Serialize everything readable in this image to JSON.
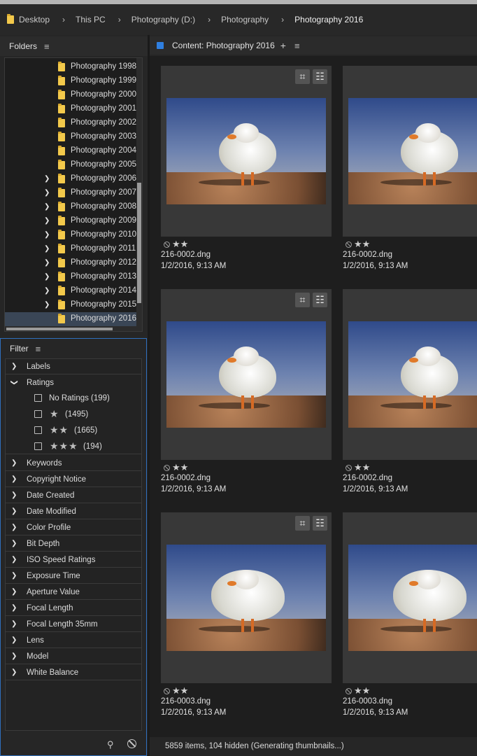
{
  "breadcrumb": {
    "items": [
      "Desktop",
      "This PC",
      "Photography (D:)",
      "Photography",
      "Photography 2016"
    ],
    "separator": "›"
  },
  "folders": {
    "title": "Folders",
    "items": [
      {
        "label": "Photography 1998",
        "expandable": false
      },
      {
        "label": "Photography 1999",
        "expandable": false
      },
      {
        "label": "Photography 2000",
        "expandable": false
      },
      {
        "label": "Photography 2001",
        "expandable": false
      },
      {
        "label": "Photography 2002",
        "expandable": false
      },
      {
        "label": "Photography 2003",
        "expandable": false
      },
      {
        "label": "Photography 2004",
        "expandable": false
      },
      {
        "label": "Photography 2005",
        "expandable": false
      },
      {
        "label": "Photography 2006",
        "expandable": true
      },
      {
        "label": "Photography 2007",
        "expandable": true
      },
      {
        "label": "Photography 2008",
        "expandable": true
      },
      {
        "label": "Photography 2009",
        "expandable": true
      },
      {
        "label": "Photography 2010",
        "expandable": true
      },
      {
        "label": "Photography 2011",
        "expandable": true
      },
      {
        "label": "Photography 2012",
        "expandable": true
      },
      {
        "label": "Photography 2013",
        "expandable": true
      },
      {
        "label": "Photography 2014",
        "expandable": true
      },
      {
        "label": "Photography 2015",
        "expandable": true
      },
      {
        "label": "Photography 2016",
        "expandable": false,
        "selected": true
      }
    ]
  },
  "filter": {
    "title": "Filter",
    "categories_before": [
      "Labels"
    ],
    "ratings": {
      "label": "Ratings",
      "options": [
        {
          "text": "No Ratings",
          "stars": "",
          "count": "(199)"
        },
        {
          "text": "",
          "stars": "★",
          "count": "(1495)"
        },
        {
          "text": "",
          "stars": "★★",
          "count": "(1665)"
        },
        {
          "text": "",
          "stars": "★★★",
          "count": "(194)"
        }
      ]
    },
    "categories_after": [
      "Keywords",
      "Copyright Notice",
      "Date Created",
      "Date Modified",
      "Color Profile",
      "Bit Depth",
      "ISO Speed Ratings",
      "Exposure Time",
      "Aperture Value",
      "Focal Length",
      "Focal Length 35mm",
      "Lens",
      "Model",
      "White Balance"
    ]
  },
  "content": {
    "title": "Content: Photography 2016",
    "plus": "+",
    "items": [
      {
        "name": "216-0002.dng",
        "date": "1/2/2016, 9:13 AM",
        "stars": "★★",
        "rating": 2,
        "edited": true
      },
      {
        "name": "216-0002.dng",
        "date": "1/2/2016, 9:13 AM",
        "stars": "★★",
        "rating": 2,
        "edited": false
      },
      {
        "name": "216-0002.dng",
        "date": "1/2/2016, 9:13 AM",
        "stars": "★★",
        "rating": 2,
        "edited": true
      },
      {
        "name": "216-0002.dng",
        "date": "1/2/2016, 9:13 AM",
        "stars": "★★",
        "rating": 2,
        "edited": false
      },
      {
        "name": "216-0003.dng",
        "date": "1/2/2016, 9:13 AM",
        "stars": "★★",
        "rating": 2,
        "edited": true
      },
      {
        "name": "216-0003.dng",
        "date": "1/2/2016, 9:13 AM",
        "stars": "★★",
        "rating": 2,
        "edited": false
      }
    ]
  },
  "status": {
    "text": "5859 items, 104 hidden (Generating thumbnails...)"
  },
  "colors": {
    "accent": "#2f7fe0",
    "folder": "#f3c94b",
    "panel": "#262626",
    "card": "#383838"
  },
  "icons": {
    "menu": "≡",
    "chevron_right": "›",
    "chevron_down": "⌄",
    "pin": "📌",
    "crop": "⌗",
    "adjust": "≑"
  }
}
